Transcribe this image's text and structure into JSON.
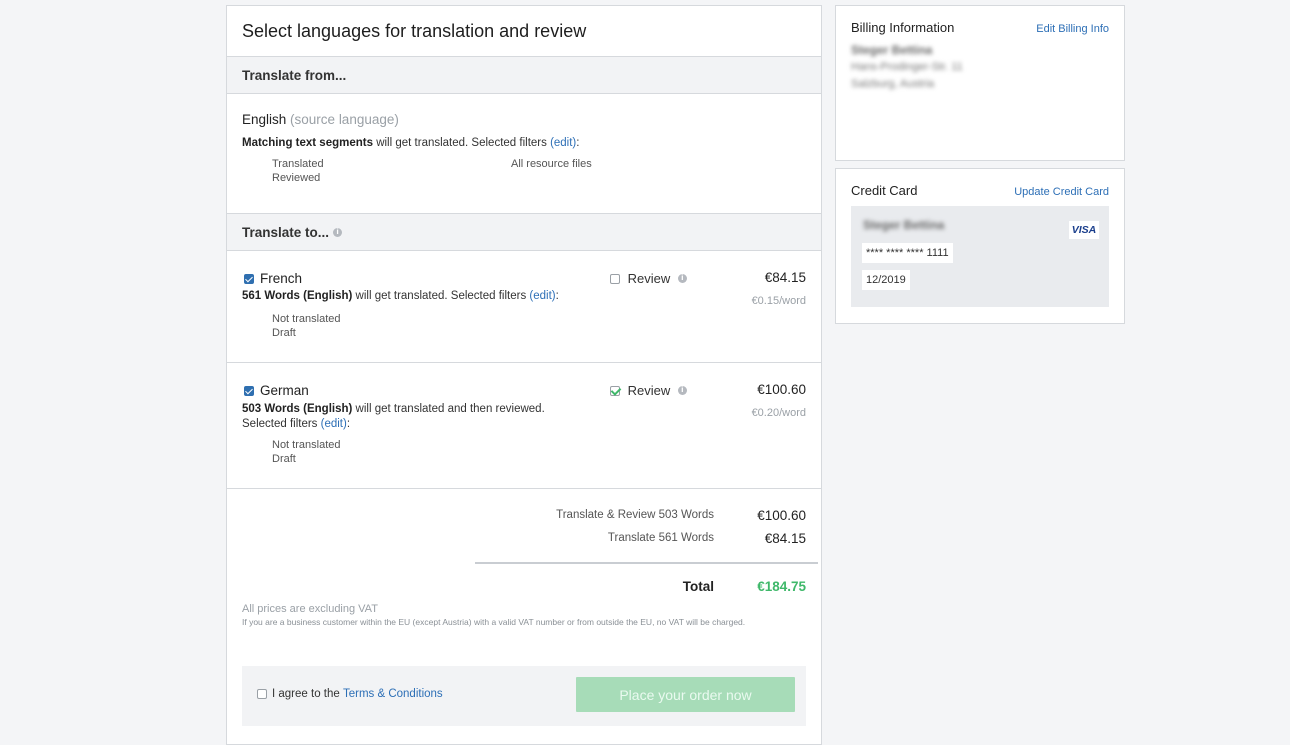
{
  "page": {
    "title": "Select languages for translation and review"
  },
  "source": {
    "section_label": "Translate from...",
    "language": "English",
    "language_note": "(source language)",
    "match_prefix": "Matching text segments",
    "match_rest": " will get translated. Selected filters ",
    "edit_label": "(edit)",
    "colon": ":",
    "filters_col1": [
      "Translated",
      "Reviewed"
    ],
    "filters_col2": [
      "All resource files"
    ]
  },
  "targets": {
    "section_label": "Translate to...",
    "review_label": "Review",
    "edit_label": "(edit)",
    "items": [
      {
        "name": "French",
        "checked": true,
        "review": false,
        "price": "€84.15",
        "per_word": "€0.15/word",
        "words": "561 Words (English)",
        "text": " will get translated. Selected filters ",
        "filters": [
          "Not translated",
          "Draft"
        ]
      },
      {
        "name": "German",
        "checked": true,
        "review": true,
        "price": "€100.60",
        "per_word": "€0.20/word",
        "words": "503 Words (English)",
        "text": " will get translated and then reviewed.",
        "text2": "Selected filters ",
        "filters": [
          "Not translated",
          "Draft"
        ]
      }
    ]
  },
  "summary": {
    "lines": [
      {
        "label": "Translate & Review 503 Words",
        "value": "€100.60"
      },
      {
        "label": "Translate 561 Words",
        "value": "€84.15"
      }
    ],
    "total_label": "Total",
    "total_value": "€184.75",
    "total_color": "#3fb86a",
    "vat_note": "All prices are excluding VAT",
    "vat_detail": "If you are a business customer within the EU (except Austria) with a valid VAT number or from outside the EU, no VAT will be charged."
  },
  "order": {
    "agree_prefix": "I agree to the ",
    "terms_link": "Terms & Conditions",
    "place_button": "Place your order now"
  },
  "billing": {
    "title": "Billing Information",
    "edit_link": "Edit Billing Info",
    "name": "Steger Bettina",
    "street": "Hans-Prodinger-Str. 11",
    "city": "Salzburg, Austria"
  },
  "credit_card": {
    "title": "Credit Card",
    "update_link": "Update Credit Card",
    "holder": "Steger Bettina",
    "number": "**** **** **** 1111",
    "expiry": "12/2019",
    "brand": "VISA"
  },
  "colors": {
    "accent_blue": "#2d6fb6",
    "checkbox_blue": "#2f6fb0",
    "success_green": "#3fb86a",
    "button_disabled_green": "#a7dcb8"
  }
}
